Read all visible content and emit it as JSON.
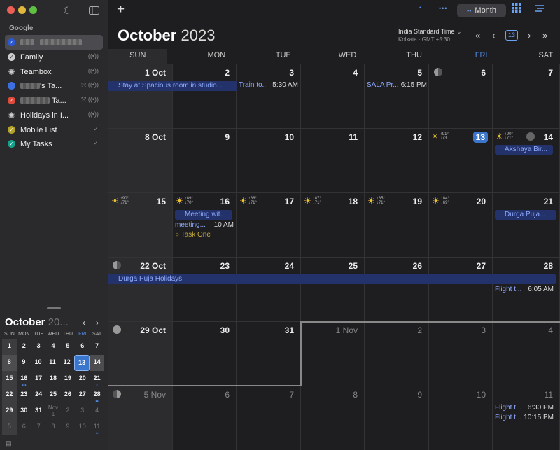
{
  "sidebar": {
    "section_title": "Google",
    "calendars": [
      {
        "label": "",
        "color": "#2c59d3",
        "checked": true,
        "selected": true,
        "right": ""
      },
      {
        "label": "Family",
        "color": "#ddd",
        "right": "((•))"
      },
      {
        "label": "Teambox",
        "color": "#ddd",
        "right": "((•))"
      },
      {
        "label": "'s Ta...",
        "color": "#3d6fe0",
        "right": "⤧ ((•))"
      },
      {
        "label": "Ta...",
        "color": "#e04a3a",
        "right": "⤧ ((•))"
      },
      {
        "label": "Holidays in I...",
        "color": "#ddd",
        "right": "((•))"
      },
      {
        "label": "Mobile List",
        "color": "#b5a227",
        "right": "✓"
      },
      {
        "label": "My Tasks",
        "color": "#16a08c",
        "right": "✓"
      }
    ],
    "mini": {
      "month": "October",
      "year": "20...",
      "weekdays": [
        "SUN",
        "MON",
        "TUE",
        "WED",
        "THU",
        "FRI",
        "SAT"
      ],
      "rows": [
        [
          "1",
          "2",
          "3",
          "4",
          "5",
          "6",
          "7"
        ],
        [
          "8",
          "9",
          "10",
          "11",
          "12",
          "13",
          "14"
        ],
        [
          "15",
          "16",
          "17",
          "18",
          "19",
          "20",
          "21"
        ],
        [
          "22",
          "23",
          "24",
          "25",
          "26",
          "27",
          "28"
        ],
        [
          "29",
          "30",
          "31",
          "Nov 1",
          "2",
          "3",
          "4"
        ],
        [
          "5",
          "6",
          "7",
          "8",
          "9",
          "10",
          "11"
        ]
      ]
    }
  },
  "toolbar": {
    "add": "+",
    "more": "•••",
    "view_label": "Month"
  },
  "header": {
    "month": "October",
    "year": "2023",
    "timezone": "India Standard Time",
    "timezone_sub": "Kolkata · GMT +5:30",
    "today_num": "13"
  },
  "weekdays": [
    "SUN",
    "MON",
    "TUE",
    "WED",
    "THU",
    "FRI",
    "SAT"
  ],
  "weeks": [
    {
      "days": [
        "1 Oct",
        "2",
        "3",
        "4",
        "5",
        "6",
        "7"
      ]
    },
    {
      "days": [
        "8 Oct",
        "9",
        "10",
        "11",
        "12",
        "13",
        "14"
      ]
    },
    {
      "days": [
        "15",
        "16",
        "17",
        "18",
        "19",
        "20",
        "21"
      ]
    },
    {
      "days": [
        "22 Oct",
        "23",
        "24",
        "25",
        "26",
        "27",
        "28"
      ]
    },
    {
      "days": [
        "29 Oct",
        "30",
        "31",
        "1 Nov",
        "2",
        "3",
        "4"
      ]
    },
    {
      "days": [
        "5 Nov",
        "6",
        "7",
        "8",
        "9",
        "10",
        "11"
      ]
    }
  ],
  "weather": {
    "w2": [
      {
        "hi": "↑91°",
        "lo": "↓73"
      },
      {
        "hi": "↑90°",
        "lo": "↓71°"
      }
    ],
    "w3": [
      {
        "hi": "↑90°",
        "lo": "↓71°"
      },
      {
        "hi": "↑89°",
        "lo": "↓70°"
      },
      {
        "hi": "↑88°",
        "lo": "↓71°"
      },
      {
        "hi": "↑87°",
        "lo": "↓71°"
      },
      {
        "hi": "↑85°",
        "lo": "↓71°"
      },
      {
        "hi": "↑84°",
        "lo": "↓69°"
      }
    ]
  },
  "events": {
    "stay": "Stay at Spacious room in studio...",
    "train": "Train to...",
    "train_time": "5:30 AM",
    "sala": "SALA Pr...",
    "sala_time": "6:15 PM",
    "akshaya": "Akshaya Bir...",
    "meeting_chip": "Meeting wit...",
    "meeting": "meeting...",
    "meeting_time": "10 AM",
    "task": "Task One",
    "durga21": "Durga Puja...",
    "durga_holidays": "Durga Puja Holidays",
    "flight28": "Flight t...",
    "flight28_time": "6:05 AM",
    "flight11a": "Flight t...",
    "flight11a_time": "6:30 PM",
    "flight11b": "Flight t...",
    "flight11b_time": "10:15 PM"
  }
}
